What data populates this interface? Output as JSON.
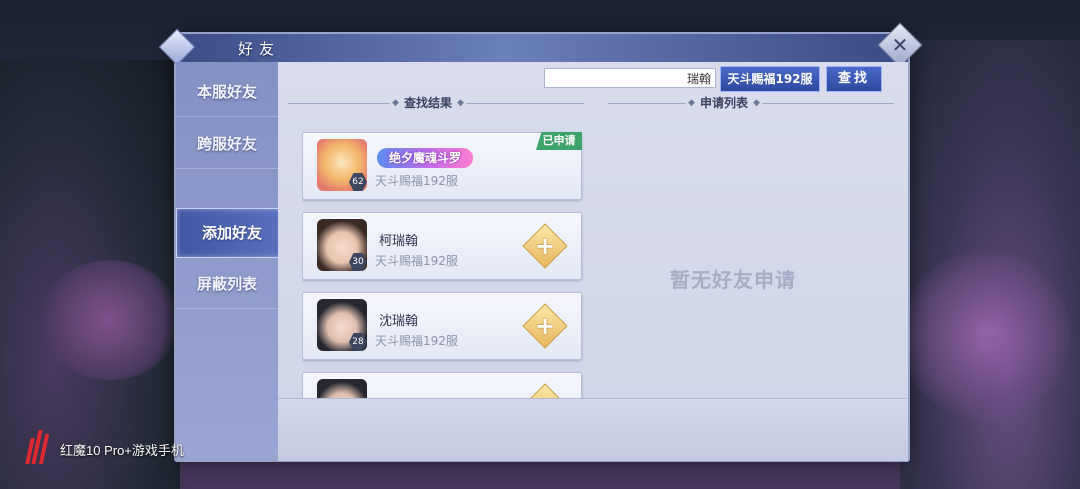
{
  "dialog": {
    "title": "好友",
    "close_label": "✕"
  },
  "sidebar": {
    "items": [
      {
        "label": "本服好友",
        "active": false
      },
      {
        "label": "跨服好友",
        "active": false
      },
      {
        "label": "添加好友",
        "active": true
      },
      {
        "label": "屏蔽列表",
        "active": false
      }
    ]
  },
  "search": {
    "input_value": "瑞翰",
    "server_label": "天斗赐福192服",
    "button_label": "查找"
  },
  "sections": {
    "results_title": "查找结果",
    "requests_title": "申请列表"
  },
  "results": [
    {
      "title_badge": "绝夕魔魂斗罗",
      "name": "",
      "level": "62",
      "server": "天斗赐福192服",
      "status": "已申请"
    },
    {
      "name": "柯瑞翰",
      "level": "30",
      "server": "天斗赐福192服",
      "add_label": "+"
    },
    {
      "name": "沈瑞翰",
      "level": "28",
      "server": "天斗赐福192服",
      "add_label": "+"
    }
  ],
  "requests": {
    "empty_message": "暂无好友申请"
  },
  "watermark": {
    "text": "红魔10 Pro+游戏手机"
  },
  "colors": {
    "accent": "#2c4a9f",
    "applied": "#3ca46a",
    "add": "#e5b85c"
  }
}
